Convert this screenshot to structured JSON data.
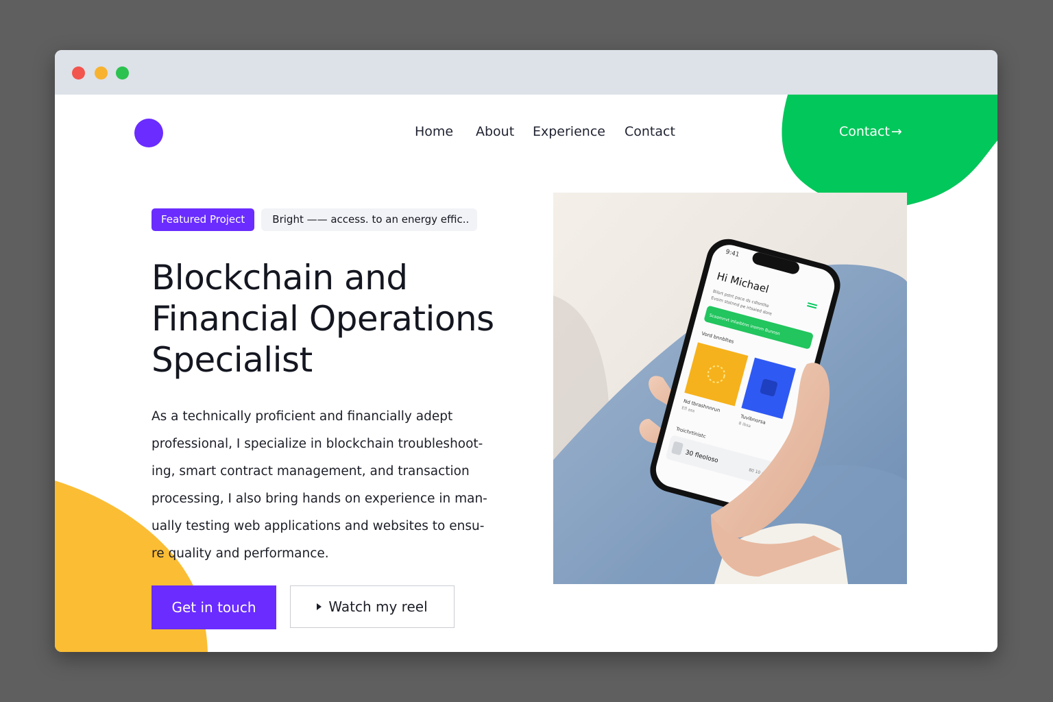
{
  "window": {
    "controls": [
      "close",
      "minimize",
      "maximize"
    ]
  },
  "colors": {
    "accent_purple": "#6a2cff",
    "accent_green": "#02c75a",
    "accent_yellow": "#fbbd34",
    "dot_red": "#f2544e",
    "dot_yellow": "#f7b230",
    "dot_green": "#2bc24f"
  },
  "header": {
    "nav": [
      {
        "label": "Home"
      },
      {
        "label": "About"
      },
      {
        "label": "Experience"
      },
      {
        "label": "Contact"
      }
    ],
    "cta_label": "Contact",
    "cta_icon": "arrow-right-icon"
  },
  "hero": {
    "badge": "Featured Project",
    "tagline": "Bright —— access. to an energy effic..",
    "title_lines": [
      "Blockchain and",
      "Financial Operations",
      "Specialist"
    ],
    "description_lines": [
      "As a technically proficient and financially adept",
      "professional, I specialize in blockchain troubleshoot-",
      "ing, smart contract management, and transaction",
      "processing, I also bring hands on experience in man-",
      "ually testing web applications and websites to ensu-",
      "re quality and performance."
    ],
    "primary_button": "Get in touch",
    "secondary_button": "Watch my reel",
    "secondary_icon": "play-icon"
  },
  "phone_screen": {
    "status": "9:41",
    "greeting": "Hi Michael",
    "subtitle_lines": [
      "Bilsrt  pstrt pace ds cdlsntlte",
      "Evsim ststnnd pe irtsaied dore"
    ],
    "banner": "Scaamnvt inliaibtnn insmm Bunnsn",
    "section_label": "Vord bnnbltes",
    "card1_title": "Nd tbrashnnrun",
    "card1_sub": "Efl  ass",
    "card2_title": "Tuvibnorsa",
    "card2_sub": "8 ibsa",
    "list_label": "Troichrtinistc",
    "list_item": "30 fleoloso",
    "list_meta": "80 10 ap"
  }
}
